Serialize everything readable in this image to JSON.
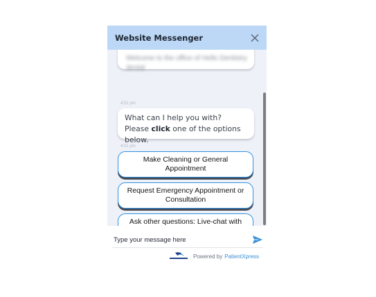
{
  "header": {
    "title": "Website Messenger"
  },
  "messages": {
    "previous_blurred": "Welcome to the office of Hello Dentistry dental",
    "previous_time": "4:51 pm",
    "prompt_time": "4:51 pm",
    "prompt_part1": "What can I help you with? Please ",
    "prompt_bold": "click",
    "prompt_part2": " one of the options below."
  },
  "options": [
    {
      "label": "Make Cleaning or General Appointment"
    },
    {
      "label": "Request Emergency Appointment or Consultation"
    },
    {
      "label": "Ask other questions: Live-chat with office, Hours, service, etc."
    }
  ],
  "composer": {
    "placeholder": "Type your message here"
  },
  "footer": {
    "powered_prefix": "Powered by",
    "brand": "PatientXpress",
    "logo_text": "PatientXpress"
  },
  "colors": {
    "header_bg": "#bcd8f6",
    "accent": "#2f8fe0",
    "chat_bg": "#eef1f8"
  }
}
